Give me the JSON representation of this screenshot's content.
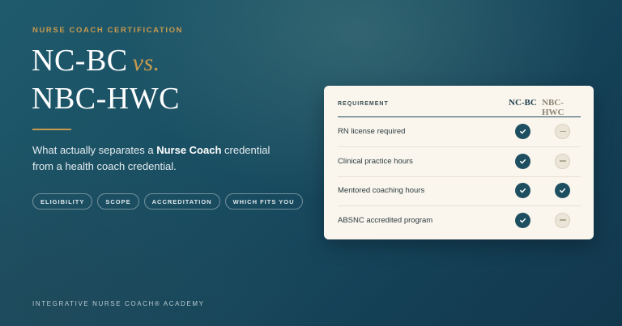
{
  "eyebrow": "NURSE COACH CERTIFICATION",
  "title": {
    "line1": "NC-BC",
    "vs": "vs.",
    "line2": "NBC-HWC"
  },
  "subtitle": {
    "prefix": "What actually separates a ",
    "emphasis": "Nurse Coach",
    "suffix": " credential from a health coach credential."
  },
  "tags": [
    "ELIGIBILITY",
    "SCOPE",
    "ACCREDITATION",
    "WHICH FITS YOU"
  ],
  "footer": "INTEGRATIVE NURSE COACH® ACADEMY",
  "table": {
    "header_requirement": "REQUIREMENT",
    "col_a": "NC-BC",
    "col_b": "NBC-HWC",
    "rows": [
      {
        "label": "RN license required",
        "a": true,
        "b": false
      },
      {
        "label": "Clinical practice hours",
        "a": true,
        "b": false
      },
      {
        "label": "Mentored coaching hours",
        "a": true,
        "b": true
      },
      {
        "label": "ABSNC accredited program",
        "a": true,
        "b": false
      }
    ]
  },
  "colors": {
    "accent": "#c99a4e",
    "background": "#1a4f63",
    "card": "#faf6ed",
    "check": "#1e4f61",
    "dash": "#ebe5d8"
  },
  "icons": {
    "yes": "check-icon",
    "no": "dash-icon"
  }
}
